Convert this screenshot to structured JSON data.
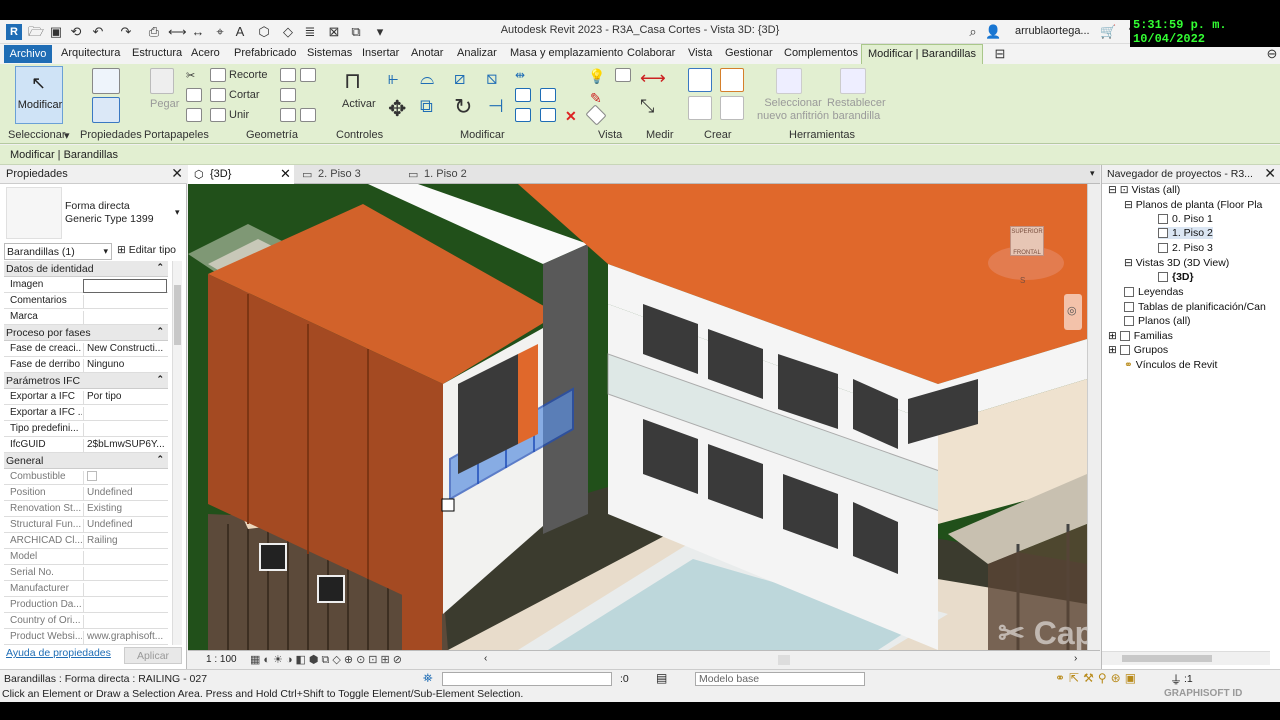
{
  "window": {
    "title": "Autodesk Revit 2023 - R3A_Casa Cortes - Vista 3D: {3D}",
    "user": "arrublaortega...",
    "clock": "5:31:59 p. m. 10/04/2022"
  },
  "menu": {
    "tabs": [
      "Archivo",
      "Arquitectura",
      "Estructura",
      "Acero",
      "Prefabricado",
      "Sistemas",
      "Insertar",
      "Anotar",
      "Analizar",
      "Masa y emplazamiento",
      "Colaborar",
      "Vista",
      "Gestionar",
      "Complementos",
      "Modificar | Barandillas"
    ],
    "active": "Modificar | Barandillas"
  },
  "ribbon": {
    "modificar_label": "Modificar",
    "pegar_label": "Pegar",
    "recorte_label": "Recorte",
    "cortar_label": "Cortar",
    "unir_label": "Unir",
    "activar_label": "Activar",
    "seleccionar_anfitrion": "Seleccionar\nnuevo anfitrión",
    "restablecer_barandilla": "Restablecer\nbarandilla",
    "panels": {
      "seleccionar": "Seleccionar",
      "propiedades": "Propiedades",
      "portapapeles": "Portapapeles",
      "geometria": "Geometría",
      "controles": "Controles",
      "modificar": "Modificar",
      "vista": "Vista",
      "medir": "Medir",
      "crear": "Crear",
      "herramientas": "Herramientas"
    }
  },
  "context_label": "Modificar | Barandillas",
  "properties": {
    "title": "Propiedades",
    "family": "Forma directa",
    "type": "Generic Type 1399",
    "selector": "Barandillas (1)",
    "edit_type": "Editar tipo",
    "groups": {
      "identidad": "Datos de identidad",
      "fases": "Proceso por fases",
      "ifc": "Parámetros IFC",
      "general": "General"
    },
    "rows_identidad": [
      {
        "k": "Imagen",
        "v": ""
      },
      {
        "k": "Comentarios",
        "v": ""
      },
      {
        "k": "Marca",
        "v": ""
      }
    ],
    "rows_fases": [
      {
        "k": "Fase de creaci...",
        "v": "New Constructi..."
      },
      {
        "k": "Fase de derribo",
        "v": "Ninguno"
      }
    ],
    "rows_ifc": [
      {
        "k": "Exportar a IFC",
        "v": "Por tipo"
      },
      {
        "k": "Exportar a IFC ...",
        "v": ""
      },
      {
        "k": "Tipo predefini...",
        "v": ""
      },
      {
        "k": "IfcGUID",
        "v": "2$bLmwSUP6Y..."
      }
    ],
    "rows_general": [
      {
        "k": "Combustible",
        "v": ""
      },
      {
        "k": "Position",
        "v": "Undefined"
      },
      {
        "k": "Renovation St...",
        "v": "Existing"
      },
      {
        "k": "Structural Fun...",
        "v": "Undefined"
      },
      {
        "k": "ARCHICAD Cl...",
        "v": "Railing"
      },
      {
        "k": "Model",
        "v": ""
      },
      {
        "k": "Serial No.",
        "v": ""
      },
      {
        "k": "Manufacturer",
        "v": ""
      },
      {
        "k": "Production Da...",
        "v": ""
      },
      {
        "k": "Country of Ori...",
        "v": ""
      },
      {
        "k": "Product Websi...",
        "v": "www.graphisoft..."
      }
    ],
    "help_link": "Ayuda de propiedades",
    "apply": "Aplicar"
  },
  "view_tabs": [
    {
      "label": "{3D}",
      "active": true
    },
    {
      "label": "2. Piso 3",
      "active": false
    },
    {
      "label": "1. Piso 2",
      "active": false
    }
  ],
  "viewcube": {
    "front": "FRONTAL",
    "top": "SUPERIOR",
    "s": "S"
  },
  "scale": "1 : 100",
  "browser": {
    "title": "Navegador de proyectos - R3...",
    "items": [
      {
        "label": "Vistas (all)",
        "level": 0,
        "toggle": "⊟"
      },
      {
        "label": "Planos de planta (Floor Pla",
        "level": 1,
        "toggle": "⊟"
      },
      {
        "label": "0. Piso 1",
        "level": 2,
        "toggle": ""
      },
      {
        "label": "1. Piso 2",
        "level": 2,
        "toggle": "",
        "selected": true
      },
      {
        "label": "2. Piso 3",
        "level": 2,
        "toggle": ""
      },
      {
        "label": "Vistas 3D (3D View)",
        "level": 1,
        "toggle": "⊟"
      },
      {
        "label": "{3D}",
        "level": 2,
        "toggle": "",
        "bold": true
      },
      {
        "label": "Leyendas",
        "level": 0,
        "toggle": ""
      },
      {
        "label": "Tablas de planificación/Can",
        "level": 0,
        "toggle": ""
      },
      {
        "label": "Planos (all)",
        "level": 0,
        "toggle": ""
      },
      {
        "label": "Familias",
        "level": 0,
        "toggle": "⊞"
      },
      {
        "label": "Grupos",
        "level": 0,
        "toggle": "⊞"
      },
      {
        "label": "Vínculos de Revit",
        "level": 0,
        "toggle": ""
      }
    ]
  },
  "status": {
    "selection": "Barandillas : Forma directa : RAILING - 027",
    "zero": ":0",
    "modelo": "Modelo base",
    "filter": ":1",
    "hint": "Click an Element or Draw a Selection Area. Press and Hold Ctrl+Shift to Toggle Element/Sub-Element Selection.",
    "watermark": "GRAPHISOFT ID",
    "capcut": "CapCut"
  },
  "colors": {
    "ribbon": "#e2efd1",
    "accent": "#1f6db5",
    "roof": "#e0682b",
    "grass": "#1f4f12"
  }
}
